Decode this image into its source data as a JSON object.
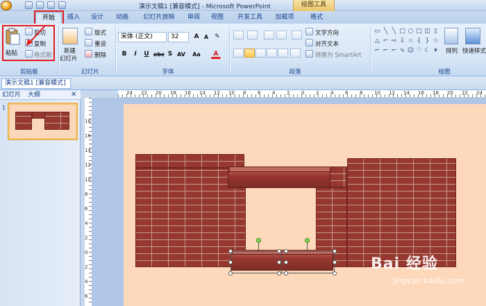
{
  "window": {
    "title": "演示文稿1 [兼容模式] - Microsoft PowerPoint",
    "context_tab_title": "绘图工具"
  },
  "ribbon_tabs": [
    "开始",
    "插入",
    "设计",
    "动画",
    "幻灯片放映",
    "审阅",
    "视图",
    "开发工具",
    "加载项",
    "格式"
  ],
  "active_tab": "开始",
  "clipboard": {
    "paste": "粘贴",
    "cut": "剪切",
    "copy": "复制",
    "format_painter": "格式刷",
    "group_label": "剪贴板"
  },
  "slides_group": {
    "new_slide_line1": "新建",
    "new_slide_line2": "幻灯片",
    "layout": "版式",
    "reset": "重设",
    "delete": "删除",
    "group_label": "幻灯片"
  },
  "font_group": {
    "font_name": "宋体 (正文)",
    "font_size": "32",
    "group_label": "字体"
  },
  "paragraph_group": {
    "text_direction": "文字方向",
    "align_text": "对齐文本",
    "convert_smartart": "转换为 SmartArt",
    "group_label": "段落"
  },
  "drawing_group": {
    "arrange": "排列",
    "quick_styles": "快速样式",
    "group_label": "绘图"
  },
  "document_tab": "演示文稿1 [兼容模式]",
  "left_pane": {
    "tab_slides": "幻灯片",
    "tab_outline": "大纲",
    "slide_number": "1"
  },
  "hruler_labels": [
    "24",
    "22",
    "20",
    "18",
    "16",
    "14",
    "12",
    "10",
    "8",
    "6",
    "4",
    "2",
    "0",
    "2",
    "4",
    "6",
    "8",
    "10",
    "12",
    "14",
    "16",
    "18",
    "20",
    "22",
    "24"
  ],
  "vruler_labels": [
    "18",
    "16",
    "14",
    "12",
    "10",
    "8",
    "6",
    "4",
    "2",
    "0",
    "2",
    "4",
    "6",
    "8"
  ],
  "watermark": {
    "logo": "Bai 经验",
    "url": "jingyan.baidu.com"
  },
  "colors": {
    "brick": "#973830",
    "slide_bg": "#fdd8bb",
    "highlight": "#e01818"
  }
}
